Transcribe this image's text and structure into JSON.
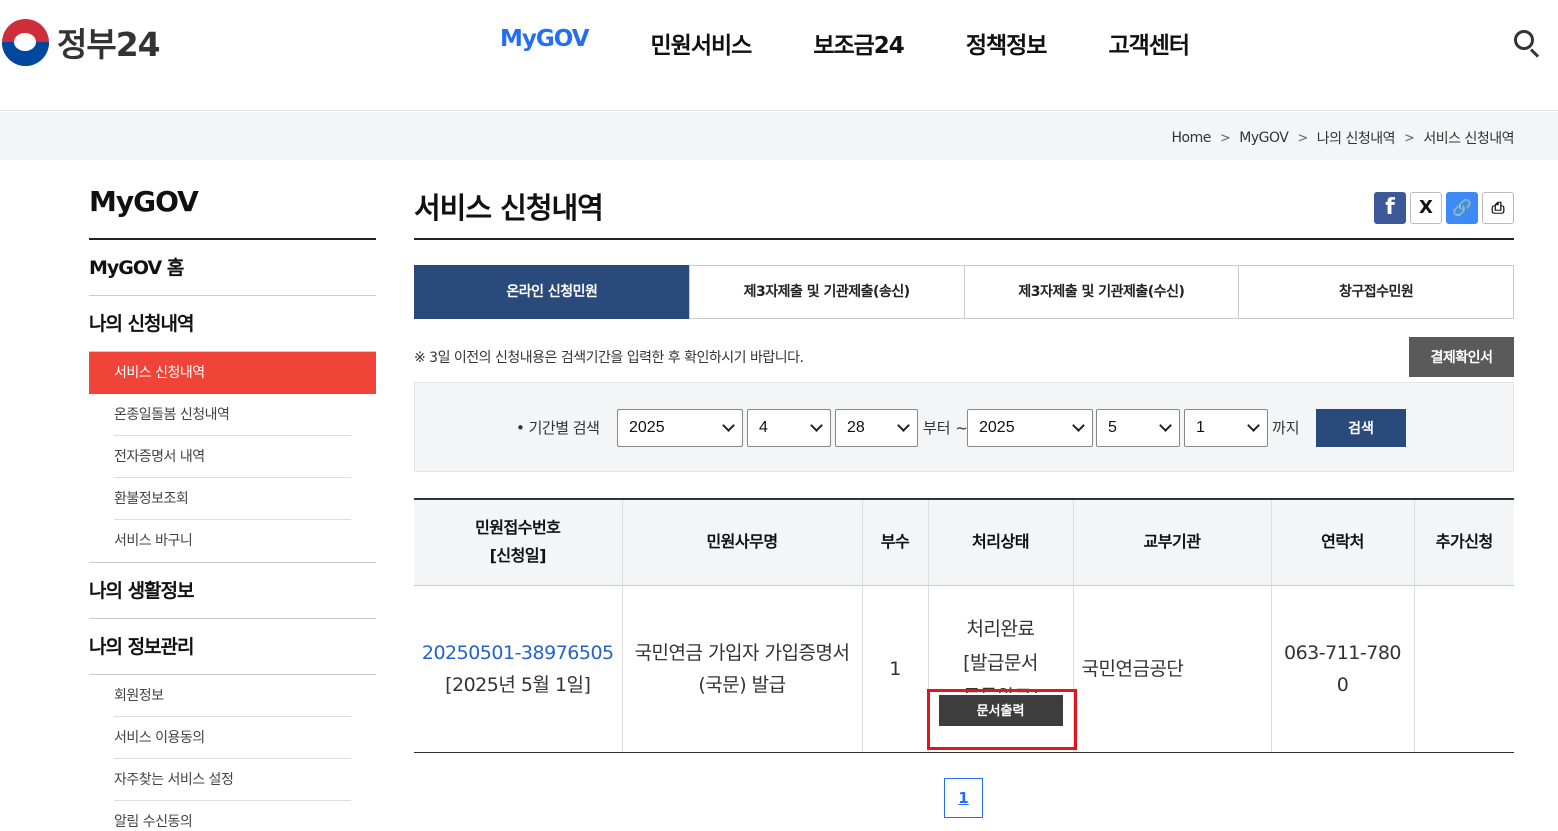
{
  "header": {
    "logo_text": "정부24",
    "nav": [
      "MyGOV",
      "민원서비스",
      "보조금24",
      "정책정보",
      "고객센터"
    ],
    "search_icon": "search-icon"
  },
  "breadcrumb": [
    "Home",
    "MyGOV",
    "나의 신청내역",
    "서비스 신청내역"
  ],
  "sidebar": {
    "title": "MyGOV",
    "home": "MyGOV 홈",
    "group1": "나의 신청내역",
    "group1_items": [
      "서비스 신청내역",
      "온종일돌봄 신청내역",
      "전자증명서 내역",
      "환불정보조회",
      "서비스 바구니"
    ],
    "group2": "나의 생활정보",
    "group3": "나의 정보관리",
    "group3_items": [
      "회원정보",
      "서비스 이용동의",
      "자주찾는 서비스 설정",
      "알림 수신동의"
    ]
  },
  "main": {
    "title": "서비스 신청내역",
    "share": {
      "facebook": "f",
      "x": "X",
      "link": "🔗",
      "print": "⎙"
    },
    "tabs": [
      "온라인 신청민원",
      "제3자제출 및 기관제출(송신)",
      "제3자제출 및 기관제출(수신)",
      "창구접수민원"
    ],
    "notice": "※ 3일 이전의 신청내용은 검색기간을 입력한 후 확인하시기 바랍니다.",
    "receipt_button": "결제확인서",
    "search": {
      "label": "• 기간별 검색",
      "from_year": "2025",
      "from_month": "4",
      "from_day": "28",
      "from_text": "부터 ~",
      "to_year": "2025",
      "to_month": "5",
      "to_day": "1",
      "to_text": "까지",
      "button": "검색"
    },
    "table": {
      "headers": [
        "민원접수번호",
        "[신청일]",
        "민원사무명",
        "부수",
        "처리상태",
        "교부기관",
        "연락처",
        "추가신청"
      ],
      "row": {
        "receipt_no": "20250501-38976505",
        "date": "[2025년 5월 1일]",
        "name_line1": "국민연금 가입자 가입증명서",
        "name_line2": "(국문) 발급",
        "copies": "1",
        "status_line1": "처리완료",
        "status_line2": "[발급문서",
        "status_line3": "등록완료]",
        "print_button": "문서출력",
        "org": "국민연금공단",
        "phone_line1": "063-711-780",
        "phone_line2": "0",
        "extra": ""
      }
    },
    "pagination": {
      "current": "1"
    }
  },
  "colors": {
    "accent": "#256ef4",
    "tab_active": "#2b4a7c",
    "side_active": "#f04438",
    "highlight": "#e0161c"
  }
}
